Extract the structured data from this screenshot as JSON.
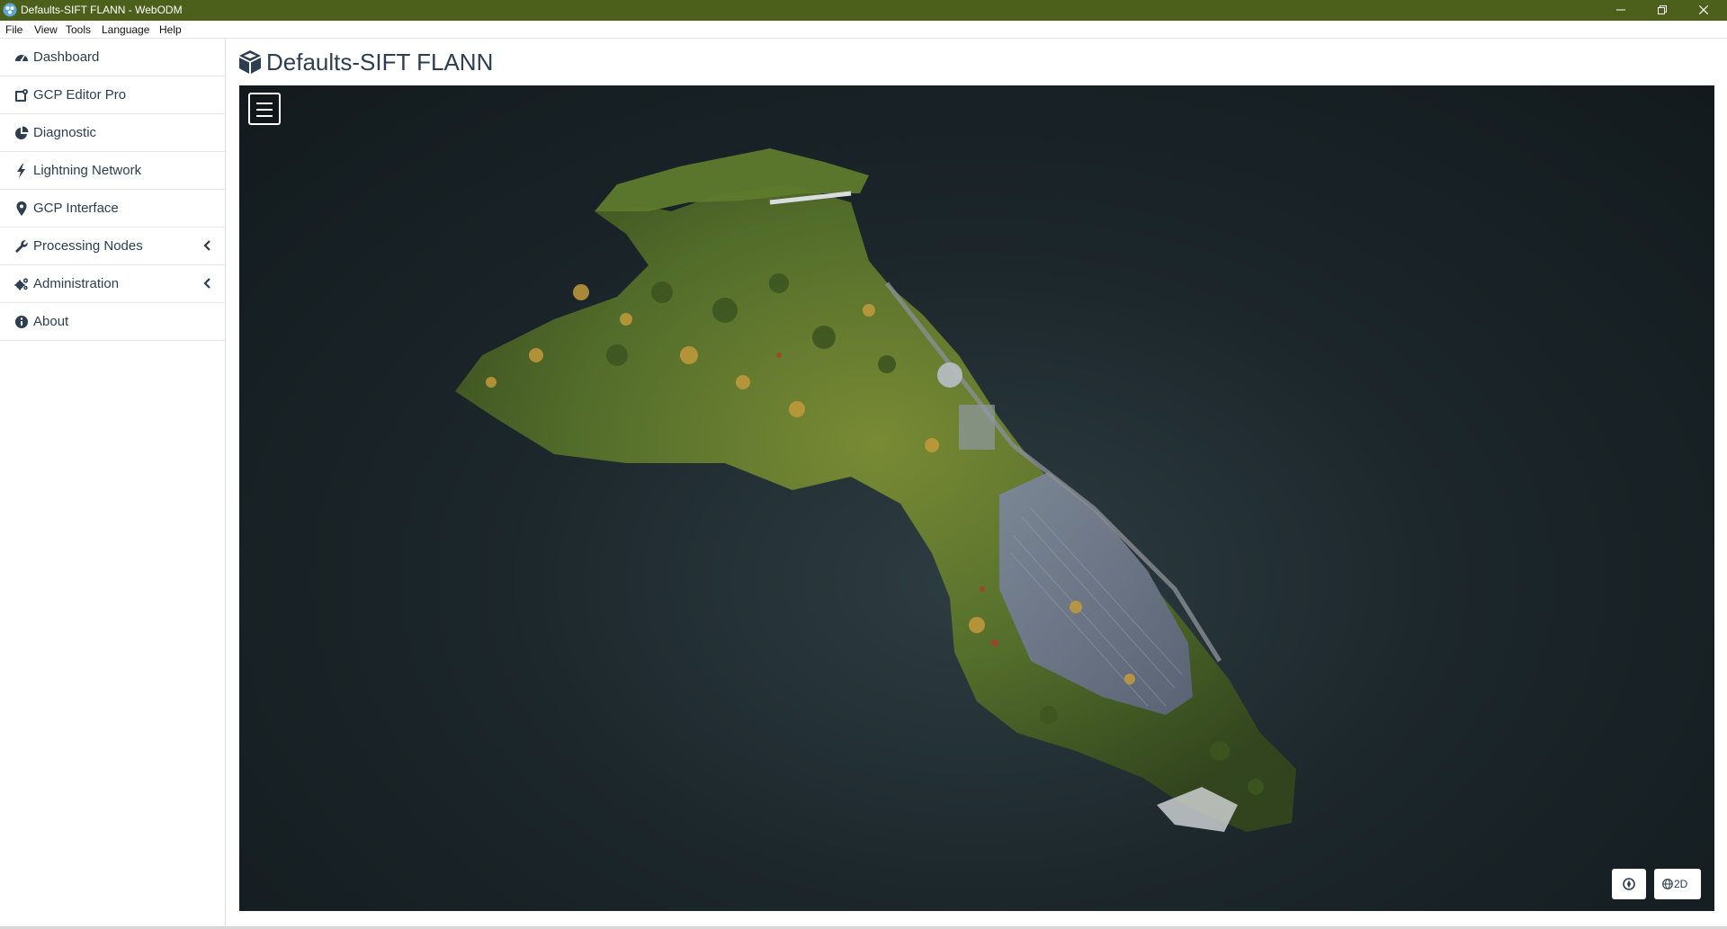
{
  "window": {
    "title": "Defaults-SIFT FLANN - WebODM",
    "controls": [
      "minimize",
      "maximize",
      "close"
    ]
  },
  "menubar": {
    "items": [
      "File",
      "View",
      "Tools",
      "Language",
      "Help"
    ]
  },
  "sidebar": {
    "items": [
      {
        "label": "Dashboard",
        "icon": "dashboard-icon"
      },
      {
        "label": "GCP Editor Pro",
        "icon": "gcp-editor-icon"
      },
      {
        "label": "Diagnostic",
        "icon": "pie-chart-icon"
      },
      {
        "label": "Lightning Network",
        "icon": "bolt-icon"
      },
      {
        "label": "GCP Interface",
        "icon": "map-marker-icon"
      },
      {
        "label": "Processing Nodes",
        "icon": "wrench-icon",
        "expandable": true
      },
      {
        "label": "Administration",
        "icon": "cogs-icon",
        "expandable": true
      },
      {
        "label": "About",
        "icon": "info-circle-icon"
      }
    ]
  },
  "page": {
    "title": "Defaults-SIFT FLANN",
    "title_icon": "cube-icon"
  },
  "viewer": {
    "menu_icon": "hamburger-menu-icon",
    "compass_icon": "compass-icon",
    "mode_label": "2D",
    "mode_icon": "globe-icon",
    "background_color": "#1c272b",
    "vegetation_colors": [
      "#4f6b22",
      "#6d8a2c",
      "#9aa43a",
      "#b9a046",
      "#3f5a1c"
    ]
  }
}
